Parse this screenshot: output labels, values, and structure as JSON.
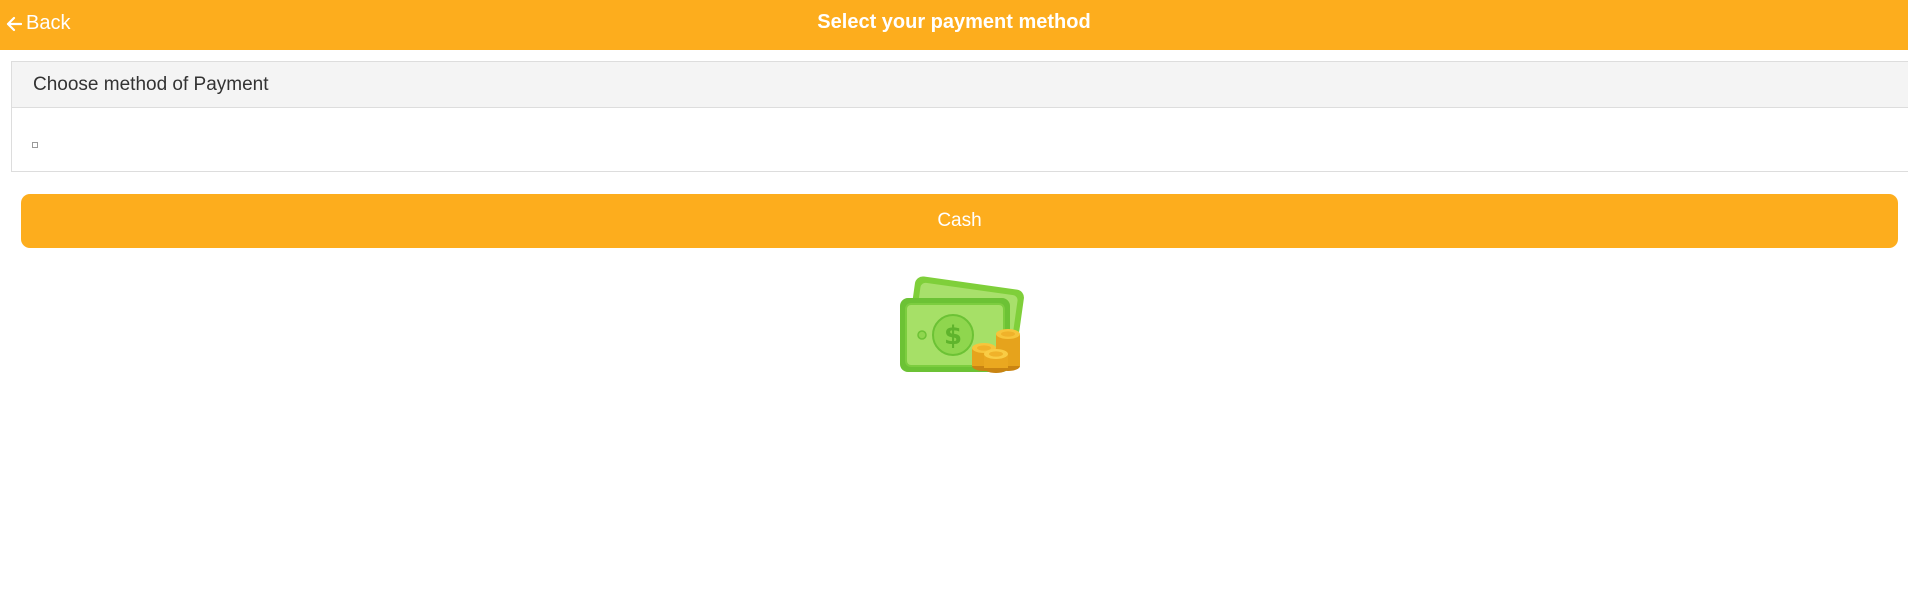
{
  "header": {
    "back_label": "Back",
    "title": "Select your payment method"
  },
  "panel": {
    "heading": "Choose method of Payment"
  },
  "payment_options": {
    "cash_label": "Cash"
  },
  "icons": {
    "back": "arrow-left-icon",
    "small_box": "small-square-icon",
    "cash_image": "cash-money-icon"
  },
  "colors": {
    "accent": "#fdad1d",
    "panel_header_bg": "#f4f4f4",
    "text_dark": "#333333"
  }
}
